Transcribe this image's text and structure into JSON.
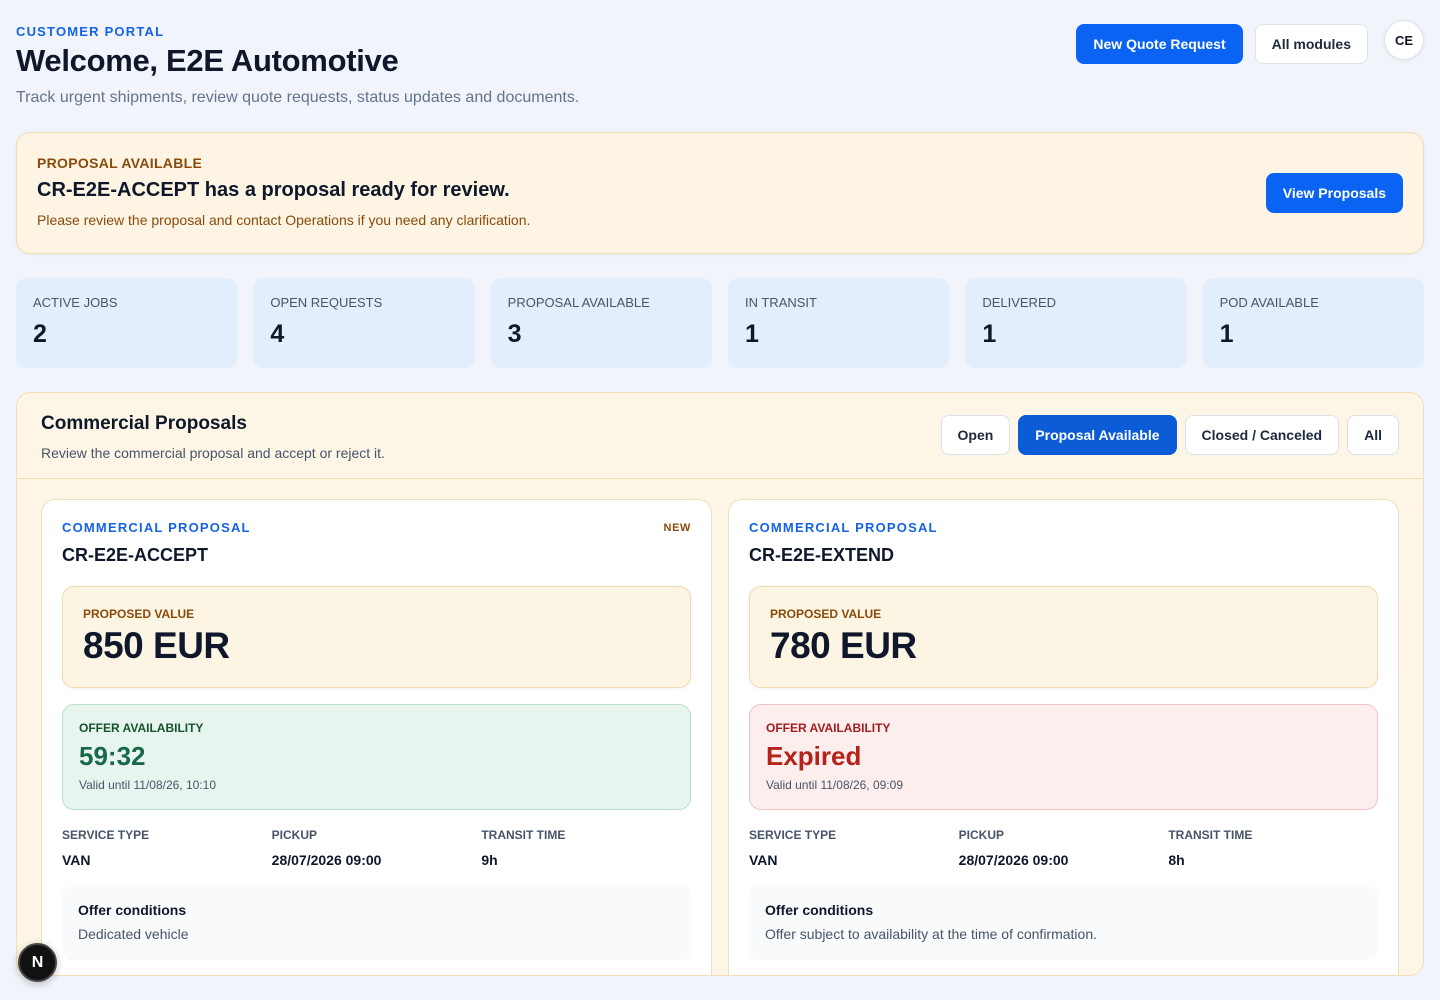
{
  "header": {
    "eyebrow": "CUSTOMER PORTAL",
    "title": "Welcome, E2E Automotive",
    "subtitle": "Track urgent shipments, review quote requests, status updates and documents.",
    "new_quote_label": "New Quote Request",
    "all_modules_label": "All modules",
    "avatar_initials": "CE"
  },
  "banner": {
    "eyebrow": "PROPOSAL AVAILABLE",
    "title": "CR-E2E-ACCEPT has a proposal ready for review.",
    "text": "Please review the proposal and contact Operations if you need any clarification.",
    "button_label": "View Proposals"
  },
  "stats": [
    {
      "label": "ACTIVE JOBS",
      "value": "2"
    },
    {
      "label": "OPEN REQUESTS",
      "value": "4"
    },
    {
      "label": "PROPOSAL AVAILABLE",
      "value": "3"
    },
    {
      "label": "IN TRANSIT",
      "value": "1"
    },
    {
      "label": "DELIVERED",
      "value": "1"
    },
    {
      "label": "POD AVAILABLE",
      "value": "1"
    }
  ],
  "proposals": {
    "title": "Commercial Proposals",
    "subtitle": "Review the commercial proposal and accept or reject it.",
    "filters": [
      {
        "label": "Open",
        "active": false
      },
      {
        "label": "Proposal Available",
        "active": true
      },
      {
        "label": "Closed / Canceled",
        "active": false
      },
      {
        "label": "All",
        "active": false
      }
    ],
    "cards": [
      {
        "eyebrow": "COMMERCIAL PROPOSAL",
        "badge": "NEW",
        "reference": "CR-E2E-ACCEPT",
        "value_label": "PROPOSED VALUE",
        "value": "850 EUR",
        "availability_label": "OFFER AVAILABILITY",
        "availability_value": "59:32",
        "availability_status": "active",
        "valid_until": "Valid until 11/08/26, 10:10",
        "service_type_label": "SERVICE TYPE",
        "service_type": "VAN",
        "pickup_label": "PICKUP",
        "pickup": "28/07/2026 09:00",
        "transit_label": "TRANSIT TIME",
        "transit": "9h",
        "conditions_title": "Offer conditions",
        "conditions_text": "Dedicated vehicle"
      },
      {
        "eyebrow": "COMMERCIAL PROPOSAL",
        "badge": "",
        "reference": "CR-E2E-EXTEND",
        "value_label": "PROPOSED VALUE",
        "value": "780 EUR",
        "availability_label": "OFFER AVAILABILITY",
        "availability_value": "Expired",
        "availability_status": "expired",
        "valid_until": "Valid until 11/08/26, 09:09",
        "service_type_label": "SERVICE TYPE",
        "service_type": "VAN",
        "pickup_label": "PICKUP",
        "pickup": "28/07/2026 09:00",
        "transit_label": "TRANSIT TIME",
        "transit": "8h",
        "conditions_title": "Offer conditions",
        "conditions_text": "Offer subject to availability at the time of confirmation."
      }
    ]
  },
  "dev_badge": "N",
  "colors": {
    "primary": "#0b63f3",
    "banner_bg": "#fdf4e3",
    "stat_bg": "#e3eefc",
    "available_green": "#17694a",
    "expired_red": "#b42318"
  }
}
